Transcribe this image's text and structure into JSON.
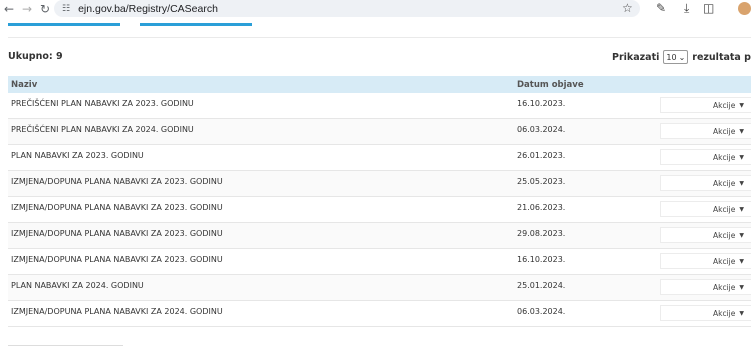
{
  "browser": {
    "url": "ejn.gov.ba/Registry/CASearch"
  },
  "summary": {
    "total_label": "Ukupno: 9",
    "show_label": "Prikazati",
    "page_size": "10",
    "results_label": "rezultata po s"
  },
  "table": {
    "columns": [
      "Naziv",
      "Datum objave"
    ],
    "action_label": "Akcije",
    "rows": [
      {
        "name": "PREČIŠĆENI PLAN NABAVKI ZA 2023. GODINU",
        "date": "16.10.2023."
      },
      {
        "name": "PREČIŠĆENI PLAN NABAVKI ZA 2024. GODINU",
        "date": "06.03.2024."
      },
      {
        "name": "PLAN NABAVKI ZA 2023. GODINU",
        "date": "26.01.2023."
      },
      {
        "name": "IZMJENA/DOPUNA PLANA NABAVKI ZA 2023. GODINU",
        "date": "25.05.2023."
      },
      {
        "name": "IZMJENA/DOPUNA PLANA NABAVKI ZA 2023. GODINU",
        "date": "21.06.2023."
      },
      {
        "name": "IZMJENA/DOPUNA PLANA NABAVKI ZA 2023. GODINU",
        "date": "29.08.2023."
      },
      {
        "name": "IZMJENA/DOPUNA PLANA NABAVKI ZA 2023. GODINU",
        "date": "16.10.2023."
      },
      {
        "name": "PLAN NABAVKI ZA 2024. GODINU",
        "date": "25.01.2024."
      },
      {
        "name": "IZMJENA/DOPUNA PLANA NABAVKI ZA 2024. GODINU",
        "date": "06.03.2024."
      }
    ]
  },
  "colors": {
    "accent": "#2a9fd8",
    "header_bg": "#d7ebf6"
  }
}
